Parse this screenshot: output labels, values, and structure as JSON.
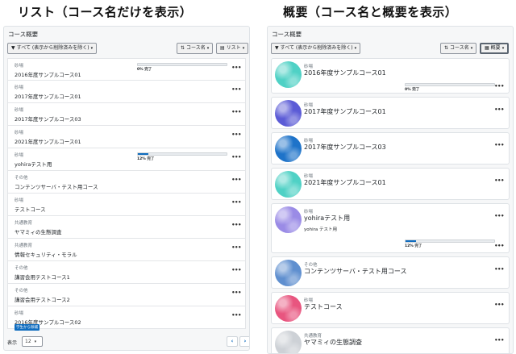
{
  "headings": {
    "left": "リスト（コース名だけを表示）",
    "right": "概要（コース名と概要を表示）"
  },
  "panel_title": "コース概要",
  "toolbar": {
    "filter_label": "すべて (表示から削除済みを除く)",
    "sort_label": "コース名",
    "view_list_label": "リスト",
    "view_summary_label": "概要"
  },
  "list_courses": [
    {
      "category": "砂場",
      "name": "2016年度サンプルコース01",
      "progress_text": "0% 完了",
      "progress": 0
    },
    {
      "category": "砂場",
      "name": "2017年度サンプルコース01"
    },
    {
      "category": "砂場",
      "name": "2017年度サンプルコース03"
    },
    {
      "category": "砂場",
      "name": "2021年度サンプルコース01"
    },
    {
      "category": "砂場",
      "name": "yohiraテスト用",
      "progress_text": "12% 完了",
      "progress": 12
    },
    {
      "category": "その他",
      "name": "コンテンツサーバ・テスト用コース"
    },
    {
      "category": "砂場",
      "name": "テストコース"
    },
    {
      "category": "共通教育",
      "name": "ヤマミィの生態調査"
    },
    {
      "category": "共通教育",
      "name": "情報セキュリティ・モラル"
    },
    {
      "category": "その他",
      "name": "講習会用テストコース1"
    },
    {
      "category": "その他",
      "name": "講習会用テストコース2"
    },
    {
      "category": "砂場",
      "name": "2016年度サンプルコース02",
      "badge": "学生から除補"
    }
  ],
  "footer": {
    "show_label": "表示",
    "per_page": "12",
    "prev_icon": "‹",
    "next_icon": "›"
  },
  "summary_courses": [
    {
      "category": "砂場",
      "name": "2016年度サンプルコース01",
      "progress_text": "0% 完了",
      "progress": 0,
      "image_color": "#4fd1c5"
    },
    {
      "category": "砂場",
      "name": "2017年度サンプルコース01",
      "image_color": "#5b5bd6"
    },
    {
      "category": "砂場",
      "name": "2017年度サンプルコース03",
      "image_color": "#1e73c9"
    },
    {
      "category": "砂場",
      "name": "2021年度サンプルコース01",
      "image_color": "#4fd1c5"
    },
    {
      "category": "砂場",
      "name": "yohiraテスト用",
      "summary": "yohira テスト用",
      "progress_text": "12% 完了",
      "progress": 12,
      "image_color": "#9a8be6"
    },
    {
      "category": "その他",
      "name": "コンテンツサーバ・テスト用コース",
      "image_color": "#5f8fcf"
    },
    {
      "category": "砂場",
      "name": "テストコース",
      "image_color": "#e8557f"
    },
    {
      "category": "共通教育",
      "name": "ヤマミィの生態調査",
      "image_color": "#cdd1d6"
    }
  ],
  "more_icon": "•••"
}
